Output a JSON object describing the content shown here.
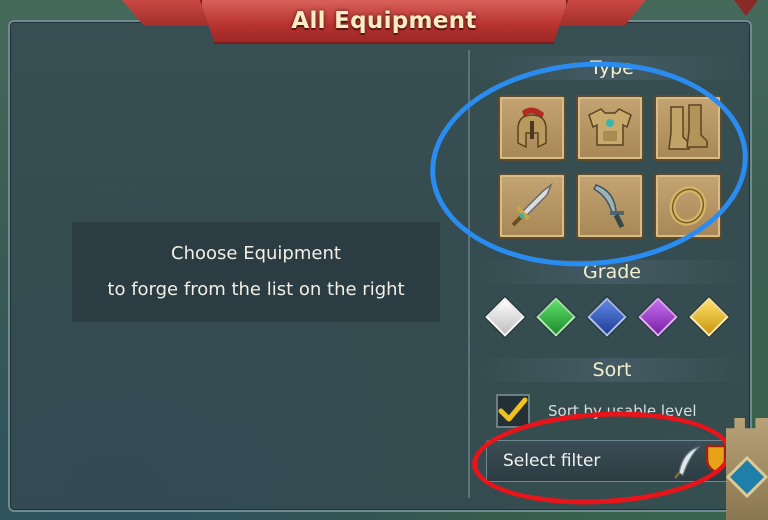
{
  "window": {
    "title": "All Equipment"
  },
  "message": {
    "line1": "Choose Equipment",
    "line2": "to forge from the list on the right"
  },
  "filters": {
    "type_heading": "Type",
    "type_items": [
      {
        "name": "helmet-icon"
      },
      {
        "name": "armor-icon"
      },
      {
        "name": "boots-icon"
      },
      {
        "name": "sword-icon"
      },
      {
        "name": "dagger-icon"
      },
      {
        "name": "ring-icon"
      }
    ],
    "grade_heading": "Grade",
    "grades": [
      {
        "name": "grade-white",
        "color": "#d8d8d8"
      },
      {
        "name": "grade-green",
        "color": "#27a33a"
      },
      {
        "name": "grade-blue",
        "color": "#2f57b4"
      },
      {
        "name": "grade-purple",
        "color": "#9b33c4"
      },
      {
        "name": "grade-gold",
        "color": "#e2b51f"
      }
    ],
    "sort_heading": "Sort",
    "sort_option": "Sort by usable level",
    "sort_checked": true,
    "select_filter": "Select filter"
  },
  "colors": {
    "title_banner": "#b8332f",
    "annotation_blue": "#2a8cf0",
    "annotation_red": "#e8141a"
  }
}
